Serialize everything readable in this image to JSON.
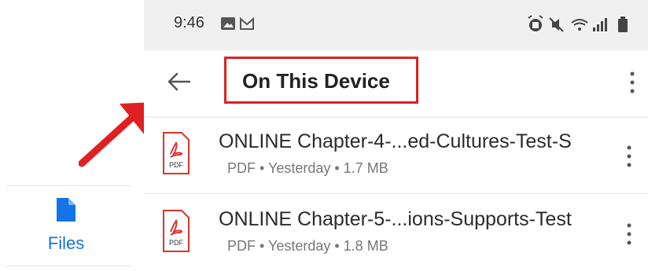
{
  "left_nav": {
    "files_label": "Files",
    "accent_color": "#1473e6"
  },
  "status_bar": {
    "time": "9:46",
    "left_icons": [
      "image-icon",
      "gmail-icon"
    ],
    "right_icons": [
      "alarm-icon",
      "mute-icon",
      "wifi-icon",
      "signal-icon",
      "battery-icon"
    ]
  },
  "app_bar": {
    "title": "On This Device",
    "back_icon": "back-arrow-icon",
    "menu_icon": "more-vertical-icon"
  },
  "files": [
    {
      "name": "ONLINE Chapter-4-...ed-Cultures-Test-S",
      "type": "PDF",
      "date": "Yesterday",
      "size": "1.7 MB",
      "meta": "PDF  •  Yesterday  •  1.7 MB",
      "icon_label": "PDF"
    },
    {
      "name": "ONLINE Chapter-5-...ions-Supports-Test",
      "type": "PDF",
      "date": "Yesterday",
      "size": "1.8 MB",
      "meta": "PDF  •  Yesterday  •  1.8 MB",
      "icon_label": "PDF"
    }
  ],
  "annotation": {
    "color": "#e02020"
  }
}
